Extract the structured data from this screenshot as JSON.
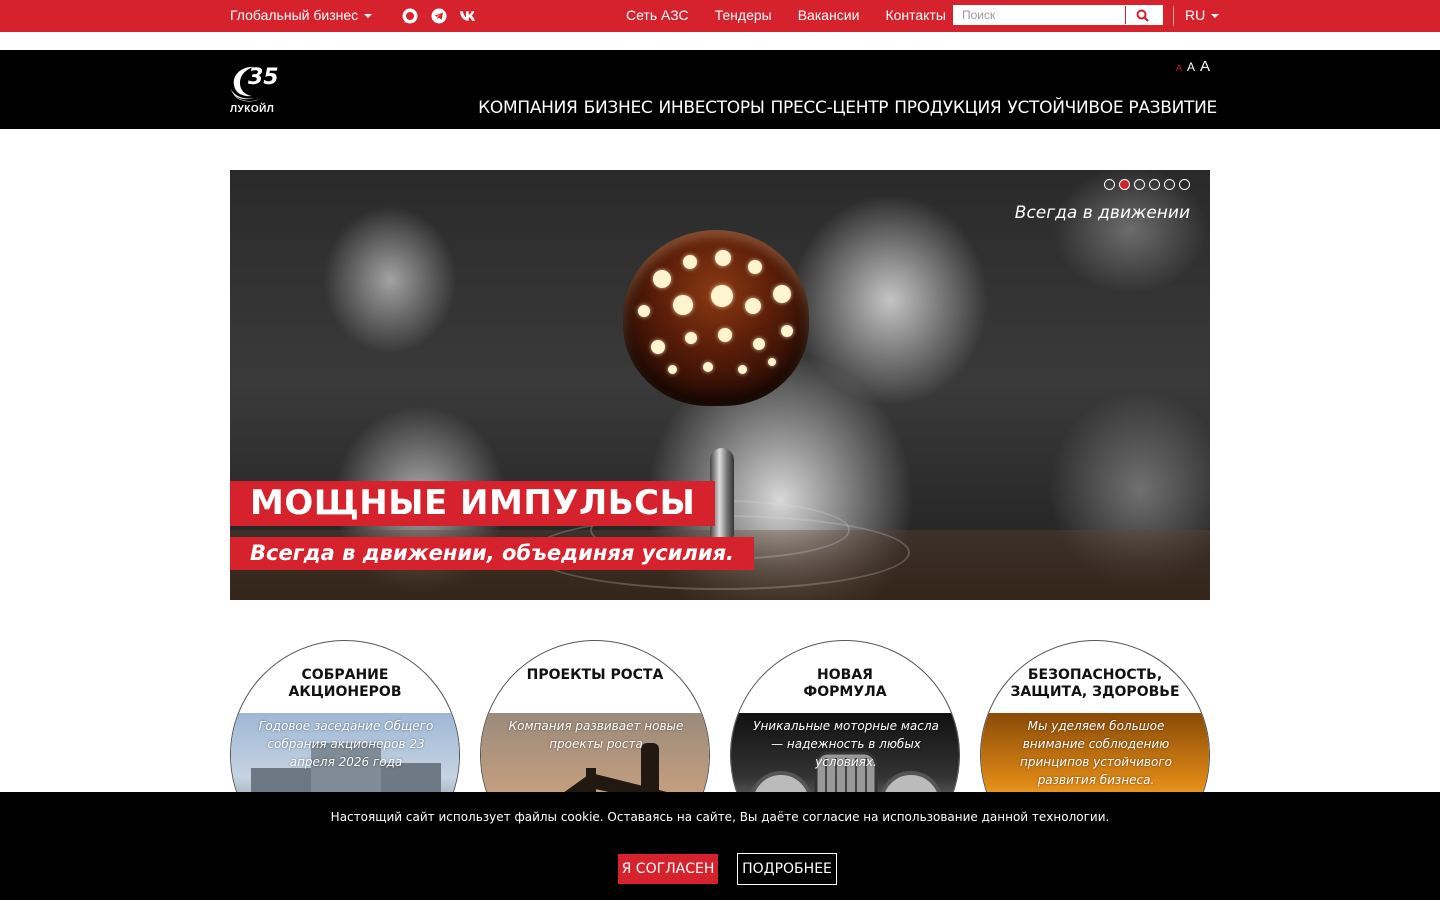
{
  "topbar": {
    "global_business": "Глобальный бизнес",
    "social": [
      {
        "name": "chat-icon"
      },
      {
        "name": "telegram-icon"
      },
      {
        "name": "vk-icon"
      }
    ],
    "nav": [
      "Сеть АЗС",
      "Тендеры",
      "Вакансии",
      "Контакты"
    ],
    "search_placeholder": "Поиск",
    "lang": "RU",
    "accent_color": "#d6222d"
  },
  "header": {
    "logo_number": "35",
    "logo_word": "ЛУКОЙЛ",
    "font_sizes": [
      "A",
      "A",
      "A"
    ],
    "nav": [
      "КОМПАНИЯ",
      "БИЗНЕС",
      "ИНВЕСТОРЫ",
      "ПРЕСС-ЦЕНТР",
      "ПРОДУКЦИЯ",
      "УСТОЙЧИВОЕ РАЗВИТИЕ"
    ]
  },
  "hero": {
    "tagline": "Всегда в движении",
    "title": "МОЩНЫЕ ИМПУЛЬСЫ",
    "subtitle": "Всегда в движении, объединяя усилия.",
    "slide_count": 6,
    "active_slide": 2
  },
  "cards": [
    {
      "title": "СОБРАНИЕ\nАКЦИОНЕРОВ",
      "desc": "Годовое заседание Общего собрания акционеров 23 апреля 2026 года"
    },
    {
      "title": "ПРОЕКТЫ РОСТА",
      "desc": "Компания развивает новые проекты роста"
    },
    {
      "title": "НОВАЯ\nФОРМУЛА",
      "desc": "Уникальные моторные масла — надежность в любых условиях."
    },
    {
      "title": "БЕЗОПАСНОСТЬ,\nЗАЩИТА, ЗДОРОВЬЕ",
      "desc": "Мы уделяем большое внимание соблюдению принципов устойчивого развития бизнеса."
    }
  ],
  "cookie": {
    "message": "Настоящий сайт использует файлы cookie. Оставаясь на сайте, Вы даёте согласие на использование данной технологии.",
    "agree": "Я СОГЛАСЕН",
    "more": "ПОДРОБНЕЕ"
  }
}
